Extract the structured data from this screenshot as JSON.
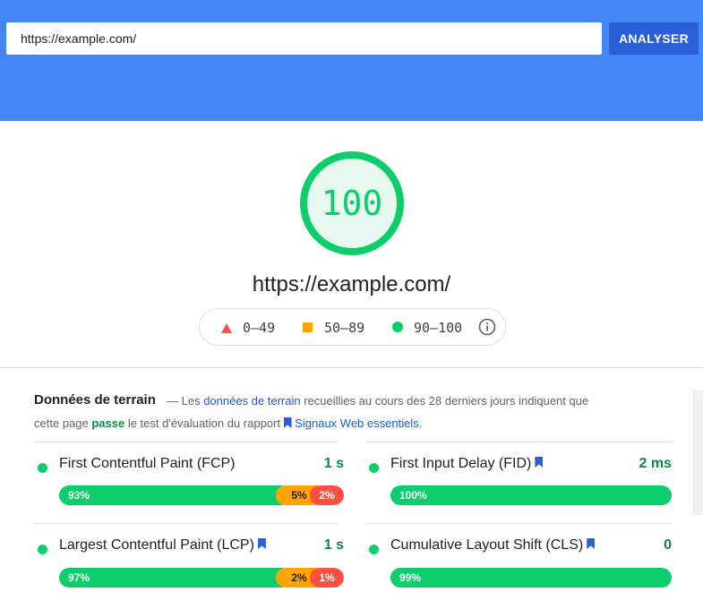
{
  "search": {
    "value": "https://example.com/",
    "button_label": "ANALYSER"
  },
  "score": {
    "value": "100",
    "fraction": 1.0,
    "url": "https://example.com/"
  },
  "legend": {
    "fail": "0–49",
    "average": "50–89",
    "pass": "90–100"
  },
  "field_data": {
    "title": "Données de terrain",
    "desc_prefix": "— Les ",
    "desc_link": "données de terrain",
    "desc_mid": " recueillies au cours des 28 derniers jours indiquent que",
    "desc_line2_start": "cette page ",
    "desc_pass": "passe",
    "desc_line2_mid": " le test d'évaluation du rapport ",
    "desc_link2": "Signaux Web essentiels",
    "desc_end": "."
  },
  "metrics": [
    {
      "name": "First Contentful Paint (FCP)",
      "value": "1 s",
      "good": "93%",
      "avg": "5%",
      "poor": "2%",
      "good_pct": 93,
      "avg_pct": 5,
      "poor_pct": 2
    },
    {
      "name": "First Input Delay (FID)",
      "value": "2 ms",
      "good": "100%",
      "good_pct": 100
    },
    {
      "name": "Largest Contentful Paint (LCP)",
      "value": "1 s",
      "good": "97%",
      "avg": "2%",
      "poor": "1%",
      "good_pct": 97,
      "avg_pct": 2,
      "poor_pct": 1
    },
    {
      "name": "Cumulative Layout Shift (CLS)",
      "value": "0",
      "good": "99%",
      "good_pct": 99
    }
  ],
  "colors": {
    "header": "#4285f4",
    "button": "#2a5fd8",
    "pass": "#0cce6b",
    "average": "#ffa400",
    "fail": "#ff4e42"
  }
}
